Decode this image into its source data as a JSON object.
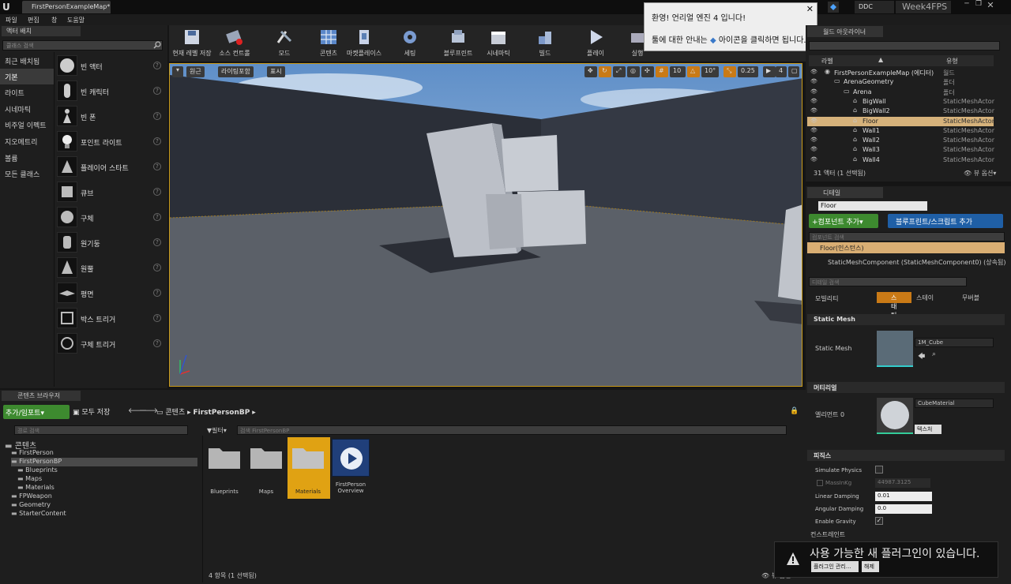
{
  "window": {
    "tab": "FirstPersonExampleMap*",
    "ddc": "DDC",
    "project": "Week4FPS"
  },
  "menu": [
    "파일",
    "편집",
    "창",
    "도움말"
  ],
  "modes": {
    "tab": "액터 배치",
    "search_placeholder": "클래스 검색",
    "categories": [
      "최근 배치됨",
      "기본",
      "라이트",
      "시네마틱",
      "비주얼 이펙트",
      "지오메트리",
      "볼륨",
      "모든 클래스"
    ],
    "selected_category": "기본",
    "items": [
      "빈 액터",
      "빈 캐릭터",
      "빈 폰",
      "포인트 라이트",
      "플레이어 스타트",
      "큐브",
      "구체",
      "원기둥",
      "원뿔",
      "평면",
      "박스 트리거",
      "구체 트리거"
    ]
  },
  "toolbar": [
    "현재 레벨 저장",
    "소스 컨트롤",
    "모드",
    "콘텐츠",
    "마켓플레이스",
    "세팅",
    "블루프린트",
    "시네마틱",
    "빌드",
    "플레이",
    "실행"
  ],
  "viewport": {
    "perspective": "원근",
    "lit": "라이팅포함",
    "show": "표시",
    "grid_snap": "10",
    "rot_snap": "10°",
    "scale_snap": "0.25",
    "cam_speed": "4"
  },
  "welcome": {
    "line1": "환영! 언리얼 엔진 4 입니다!",
    "line2a": "툴에 대한 안내는",
    "line2b": "아이콘을 클릭하면 됩니다."
  },
  "outliner": {
    "tab": "월드 아웃라이너",
    "col_label": "라벨",
    "col_type": "유형",
    "rows": [
      {
        "label": "FirstPersonExampleMap (에디터)",
        "type": "월드",
        "indent": 0
      },
      {
        "label": "ArenaGeometry",
        "type": "폴더",
        "indent": 1
      },
      {
        "label": "Arena",
        "type": "폴더",
        "indent": 2
      },
      {
        "label": "BigWall",
        "type": "StaticMeshActor",
        "indent": 3
      },
      {
        "label": "BigWall2",
        "type": "StaticMeshActor",
        "indent": 3
      },
      {
        "label": "Floor",
        "type": "StaticMeshActor",
        "indent": 3
      },
      {
        "label": "Wall1",
        "type": "StaticMeshActor",
        "indent": 3
      },
      {
        "label": "Wall2",
        "type": "StaticMeshActor",
        "indent": 3
      },
      {
        "label": "Wall3",
        "type": "StaticMeshActor",
        "indent": 3
      },
      {
        "label": "Wall4",
        "type": "StaticMeshActor",
        "indent": 3
      }
    ],
    "selected": "Floor",
    "footer": "31 액터 (1 선택됨)",
    "view_options": "뷰 옵션"
  },
  "details": {
    "tab": "디테일",
    "name": "Floor",
    "add_component": "컴포넌트 추가",
    "blueprint_script": "블루프린트/스크립트 추가",
    "component_search": "컴포넌트 검색",
    "instance": "Floor(인스턴스)",
    "component": "StaticMeshComponent (StaticMeshComponent0) (상속됨)",
    "detail_search": "디테일 검색",
    "mobility_label": "모빌리티",
    "mobility": [
      "스태틱",
      "스테이",
      "무버블"
    ],
    "section_mesh": "Static Mesh",
    "static_mesh_label": "Static Mesh",
    "static_mesh_value": "1M_Cube",
    "section_material": "머티리얼",
    "element_label": "엘리먼트 0",
    "material_value": "CubeMaterial",
    "texture_btn": "텍스처",
    "section_physics": "피직스",
    "simulate_physics": "Simulate Physics",
    "mass_label": "MassInKg",
    "mass_value": "44987.3125",
    "linear_damping": "Linear Damping",
    "linear_damping_value": "0.01",
    "angular_damping": "Angular Damping",
    "angular_damping_value": "0.0",
    "enable_gravity": "Enable Gravity",
    "section_constraints": "컨스트레인트"
  },
  "content": {
    "tab": "콘텐츠 브라우저",
    "add_import": "추가/임포트",
    "save_all": "모두 저장",
    "crumb_root": "콘텐츠",
    "crumb_current": "FirstPersonBP",
    "path_search": "경로 검색",
    "filter": "필터",
    "search_placeholder": "검색 FirstPersonBP",
    "tree": [
      "콘텐츠",
      "FirstPerson",
      "FirstPersonBP",
      "Blueprints",
      "Maps",
      "Materials",
      "FPWeapon",
      "Geometry",
      "StarterContent"
    ],
    "assets": [
      "Blueprints",
      "Maps",
      "Materials",
      "FirstPerson Overview"
    ],
    "footer": "4 항목 (1 선택됨)",
    "view_options": "뷰 옵션"
  },
  "plugin": {
    "text": "사용 가능한 새 플러그인이 있습니다.",
    "manage": "플러그인 관리...",
    "dismiss": "해제"
  }
}
